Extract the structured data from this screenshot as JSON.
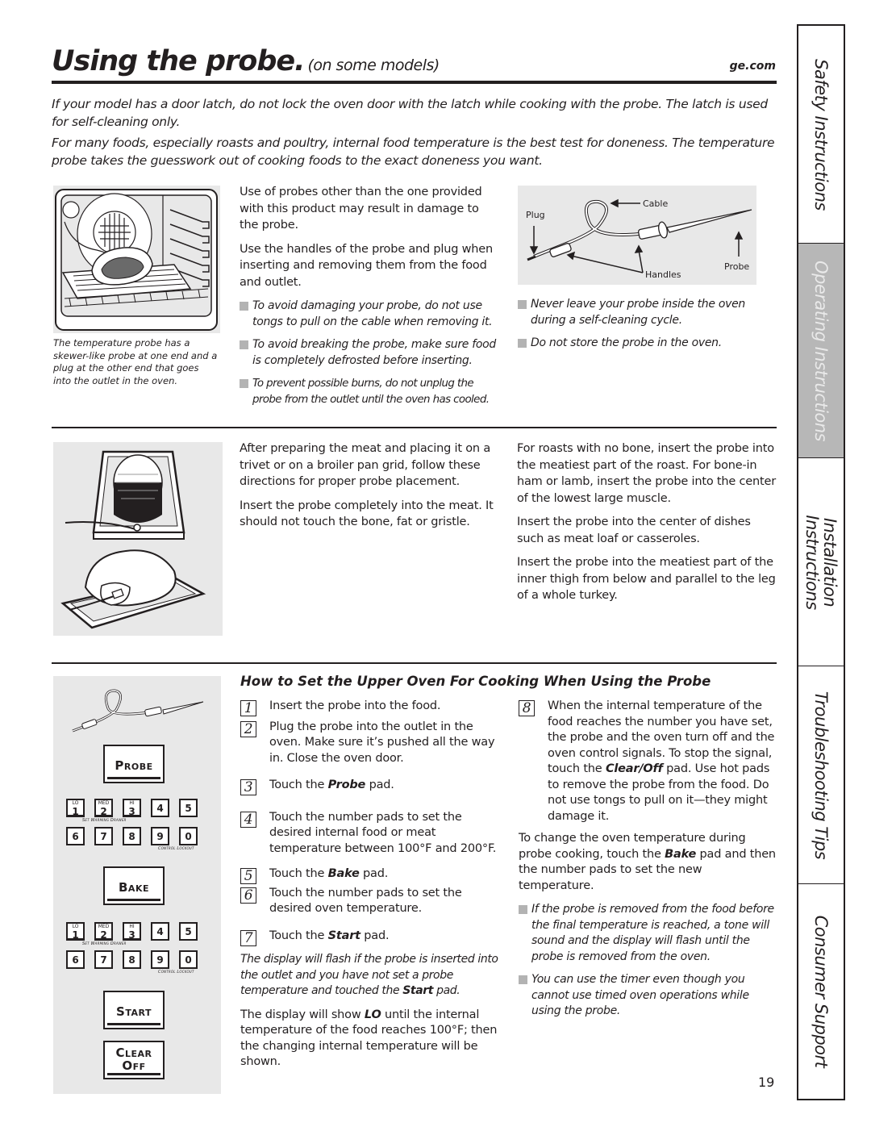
{
  "header": {
    "title": "Using the probe.",
    "subtitle": "(on some models)",
    "site": "ge.com"
  },
  "intro": [
    "If your model has a door latch, do not lock the oven door with the latch while cooking with the probe. The latch is used for self-cleaning only.",
    "For many foods, especially roasts and poultry, internal food temperature is the best test for doneness. The temperature probe takes the guesswork out of cooking foods to the exact doneness you want."
  ],
  "section1": {
    "figure_caption": "The temperature probe has a skewer-like probe at one end and a plug at the other end that goes into the outlet in the oven.",
    "paragraphs": [
      "Use of probes other than the one provided with this product may result in damage to the probe.",
      "Use the handles of the probe and plug when inserting and removing them from the food and outlet."
    ],
    "bullets_mid": [
      "To avoid damaging your probe, do not use tongs to pull on the cable when removing it.",
      "To avoid breaking the probe, make sure food is completely defrosted before inserting.",
      "To prevent possible burns, do not unplug the probe from the outlet until the oven has cooled."
    ],
    "probe_diagram": {
      "labels": {
        "plug": "Plug",
        "cable": "Cable",
        "handles": "Handles",
        "probe": "Probe"
      }
    },
    "bullets_right": [
      "Never leave your probe inside the oven during a self-cleaning cycle.",
      "Do not store the probe in the oven."
    ]
  },
  "section2": {
    "mid_paragraphs": [
      "After preparing the meat and placing it on a trivet or on a broiler pan grid, follow these directions for proper probe placement.",
      "Insert the probe completely into the meat. It should not touch the bone, fat or gristle."
    ],
    "right_paragraphs": [
      "For roasts with no bone, insert the probe into the meatiest part of the roast. For bone-in ham or lamb, insert the probe into the center of the lowest large muscle.",
      "Insert the probe into the center of dishes such as meat loaf or casseroles.",
      "Insert the probe into the meatiest part of the inner thigh from below and parallel to the leg of a whole turkey."
    ]
  },
  "section3": {
    "heading": "How to Set the Upper Oven For Cooking When Using the Probe",
    "steps": [
      {
        "num": "1",
        "pre": "Insert the probe into the food.",
        "bold": "",
        "post": ""
      },
      {
        "num": "2",
        "pre": "Plug the probe into the outlet in the oven. Make sure it’s pushed all the way in. Close the oven door.",
        "bold": "",
        "post": ""
      },
      {
        "num": "3",
        "pre": "Touch the ",
        "bold": "Probe",
        "post": " pad."
      },
      {
        "num": "4",
        "pre": "Touch the number pads to set the desired internal food or meat temperature between 100°F and 200°F.",
        "bold": "",
        "post": ""
      },
      {
        "num": "5",
        "pre": "Touch the ",
        "bold": "Bake",
        "post": " pad."
      },
      {
        "num": "6",
        "pre": "Touch the number pads to set the desired oven temperature.",
        "bold": "",
        "post": ""
      },
      {
        "num": "7",
        "pre": "Touch the ",
        "bold": "Start",
        "post": " pad."
      },
      {
        "num": "8",
        "pre": "When the internal temperature of the food reaches the number you have set, the probe and the oven turn off and the oven control signals. To stop the signal, touch the ",
        "bold": "Clear/Off",
        "post": " pad. Use hot pads to remove the probe from the food. Do not use tongs to pull on it—they might damage it."
      }
    ],
    "flash_note": {
      "pre": "The display will flash if the probe is inserted into the outlet and you have not set a probe temperature and touched the ",
      "bold": "Start",
      "post": " pad."
    },
    "lo_note": {
      "pre": "The display will show ",
      "bold": "LO",
      "post": " until the internal temperature of the food reaches 100°F; then the changing internal temperature will be shown."
    },
    "change_note": {
      "pre": "To change the oven temperature during probe cooking, touch the ",
      "bold": "Bake",
      "post": " pad and then the number pads to set the new temperature."
    },
    "bullets": [
      "If the probe is removed from the food before the final temperature is reached, a tone will sound and the display will flash until the probe is removed from the oven.",
      "You can use the timer even though you cannot use timed oven operations while using the probe."
    ]
  },
  "keypad": {
    "probe": "Probe",
    "bake": "Bake",
    "start": "Start",
    "clear": "Clear",
    "off": "Off",
    "row1": [
      {
        "digit": "1",
        "top": "LO"
      },
      {
        "digit": "2",
        "top": "MED"
      },
      {
        "digit": "3",
        "top": "HI"
      },
      {
        "digit": "4",
        "top": ""
      },
      {
        "digit": "5",
        "top": ""
      }
    ],
    "row2": [
      "6",
      "7",
      "8",
      "9",
      "0"
    ],
    "warming_label": "Set Warming Drawer",
    "lockout_label": "Control Lockout"
  },
  "side_tabs": [
    {
      "label": "Safety Instructions",
      "active": false
    },
    {
      "label": "Operating Instructions",
      "active": true
    },
    {
      "label": "Installation Instructions",
      "active": false
    },
    {
      "label": "Troubleshooting Tips",
      "active": false
    },
    {
      "label": "Consumer Support",
      "active": false
    }
  ],
  "page_number": "19",
  "colors": {
    "text": "#231f20",
    "figure_bg": "#e8e8e8",
    "bullet": "#b3b3b3",
    "active_tab": "#b7b7b7"
  }
}
